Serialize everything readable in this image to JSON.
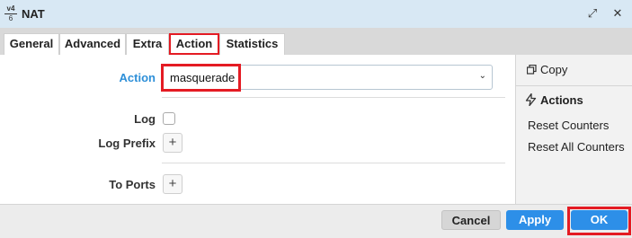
{
  "window": {
    "icon_top": "v4",
    "icon_bottom": "6",
    "title": "NAT",
    "restore_glyph": "⤢",
    "close_glyph": "✕"
  },
  "tabs": [
    {
      "label": "General"
    },
    {
      "label": "Advanced"
    },
    {
      "label": "Extra"
    },
    {
      "label": "Action",
      "highlighted": true
    },
    {
      "label": "Statistics"
    }
  ],
  "form": {
    "action_label": "Action",
    "action_value": "masquerade",
    "log_label": "Log",
    "log_checked": false,
    "log_prefix_label": "Log Prefix",
    "to_ports_label": "To Ports",
    "plus_glyph": "+",
    "chevron_glyph": "⌄"
  },
  "sidebar": {
    "copy_label": "Copy",
    "actions_heading": "Actions",
    "reset_counters": "Reset Counters",
    "reset_all_counters": "Reset All Counters"
  },
  "buttons": {
    "cancel": "Cancel",
    "apply": "Apply",
    "ok": "OK"
  },
  "icons": {
    "copy": "copy-icon",
    "actions": "lightning-icon"
  },
  "colors": {
    "accent": "#2d8fe8",
    "highlight": "#e41b23",
    "titlebar": "#d8e8f4"
  }
}
